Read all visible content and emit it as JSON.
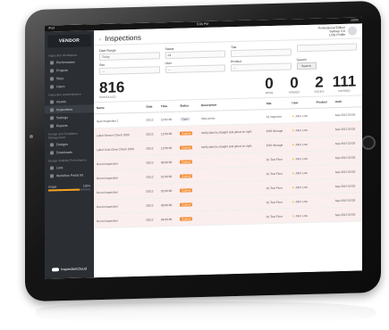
{
  "status_bar": {
    "left": "iPad",
    "time": "5:08 PM",
    "right": "100%"
  },
  "sidebar": {
    "logo": "VENDOR",
    "sections": [
      {
        "title": "Inspection Workspace",
        "items": [
          "Performance",
          "Projects",
          "Sites",
          "Users"
        ]
      },
      {
        "title": "Inspection Administration",
        "items": [
          "Assets",
          "Inspections",
          "Settings",
          "Reports"
        ]
      },
      {
        "title": "Design and Templates Management",
        "items": [
          "Designs",
          "Downloads"
        ]
      },
      {
        "title": "Design Visibility Performance",
        "items": [
          "Lists",
          "Workflow Portal Kit"
        ]
      }
    ],
    "meter": {
      "label": "Usage",
      "value": "100%",
      "fraction": 0.75
    },
    "brand": "InspectionCloud"
  },
  "header": {
    "title": "Inspections",
    "back": "‹",
    "user_line1": "Professional Edition",
    "user_line2": "Sydney, CA",
    "user_line3": "LOG Profile"
  },
  "filters": [
    {
      "label": "Date Range",
      "value": "Today"
    },
    {
      "label": "Status",
      "value": "All"
    },
    {
      "label": "Title",
      "value": ""
    },
    {
      "label": "",
      "value": ""
    },
    {
      "label": "Site",
      "value": "---"
    },
    {
      "label": "User",
      "value": "---"
    },
    {
      "label": "Product",
      "value": "---"
    },
    {
      "label": "Search",
      "value": "Search"
    }
  ],
  "stats": [
    {
      "value": "816",
      "label": "SCHEDULED"
    },
    {
      "value": "0",
      "label": "OPEN"
    },
    {
      "value": "0",
      "label": "MISSED"
    },
    {
      "value": "2",
      "label": "ISSUES"
    },
    {
      "value": "111",
      "label": "EXPIRED"
    }
  ],
  "table": {
    "columns": [
      "Name",
      "Date",
      "Time",
      "Status",
      "Description",
      "Site",
      "User",
      "Product",
      "Until"
    ],
    "rows": [
      {
        "name": "Spot Inspection 1",
        "date": "03/12",
        "time": "10:02:00",
        "status": "Open",
        "desc": "Take photo",
        "site": "01 Inspector",
        "user": "John Low",
        "product": "",
        "until": "Sep 2015 02:00",
        "overdue": false
      },
      {
        "name": "Label Sensor Check 1000",
        "date": "03/12",
        "time": "12:00:00",
        "status": "Expired",
        "desc": "Verify label is straight and glued on right",
        "site": "EHS Storage",
        "user": "John Low",
        "product": "",
        "until": "Sep 2015 02:00",
        "overdue": true
      },
      {
        "name": "Label Cost Clear Check 1000",
        "date": "03/12",
        "time": "12:00:00",
        "status": "Expired",
        "desc": "Verify label is straight and glued on right",
        "site": "EHS Storage",
        "user": "John Low",
        "product": "",
        "until": "Sep 2015 02:00",
        "overdue": true
      },
      {
        "name": "Room Inspection",
        "date": "03/12",
        "time": "00:00:00",
        "status": "Expired",
        "desc": "",
        "site": "01 Test Floor",
        "user": "John Low",
        "product": "",
        "until": "Sep 2015 02:00",
        "overdue": true
      },
      {
        "name": "Room Inspection",
        "date": "03/12",
        "time": "01:00:00",
        "status": "Expired",
        "desc": "",
        "site": "01 Test Floor",
        "user": "John Low",
        "product": "",
        "until": "Sep 2015 02:00",
        "overdue": true
      },
      {
        "name": "Room Inspection",
        "date": "03/12",
        "time": "02:00:00",
        "status": "Expired",
        "desc": "",
        "site": "01 Test Floor",
        "user": "John Low",
        "product": "",
        "until": "Sep 2015 02:00",
        "overdue": true
      },
      {
        "name": "Room Inspection",
        "date": "03/12",
        "time": "03:00:00",
        "status": "Expired",
        "desc": "",
        "site": "01 Test Floor",
        "user": "John Low",
        "product": "",
        "until": "Sep 2015 02:00",
        "overdue": true
      },
      {
        "name": "Room Inspection",
        "date": "03/12",
        "time": "04:00:00",
        "status": "Expired",
        "desc": "",
        "site": "01 Test Floor",
        "user": "John Low",
        "product": "",
        "until": "Sep 2015 02:00",
        "overdue": true
      }
    ]
  }
}
